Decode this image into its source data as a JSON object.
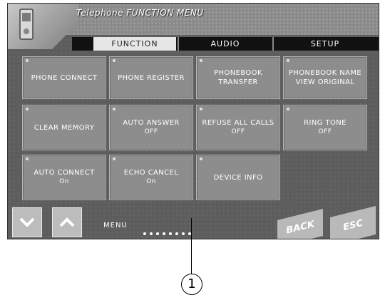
{
  "title": "Telephone FUNCTION MENU",
  "tabs": [
    "FUNCTION",
    "AUDIO",
    "SETUP"
  ],
  "buttons": {
    "phone_connect": {
      "label": "PHONE CONNECT"
    },
    "phone_register": {
      "label": "PHONE REGISTER"
    },
    "phonebook_transfer": {
      "label": "PHONEBOOK TRANSFER"
    },
    "phonebook_name_view": {
      "label": "PHONEBOOK NAME VIEW ORIGINAL"
    },
    "clear_memory": {
      "label": "CLEAR MEMORY"
    },
    "auto_answer": {
      "label": "AUTO ANSWER",
      "value": "OFF"
    },
    "refuse_all_calls": {
      "label": "REFUSE ALL CALLS",
      "value": "OFF"
    },
    "ring_tone": {
      "label": "RING TONE",
      "value": "OFF"
    },
    "auto_connect": {
      "label": "AUTO CONNECT",
      "value": "On"
    },
    "echo_cancel": {
      "label": "ECHO CANCEL",
      "value": "On"
    },
    "device_info": {
      "label": "DEVICE INFO"
    }
  },
  "bottom": {
    "page_label": "MENU",
    "back": "BACK",
    "esc": "ESC"
  },
  "callout": "1"
}
